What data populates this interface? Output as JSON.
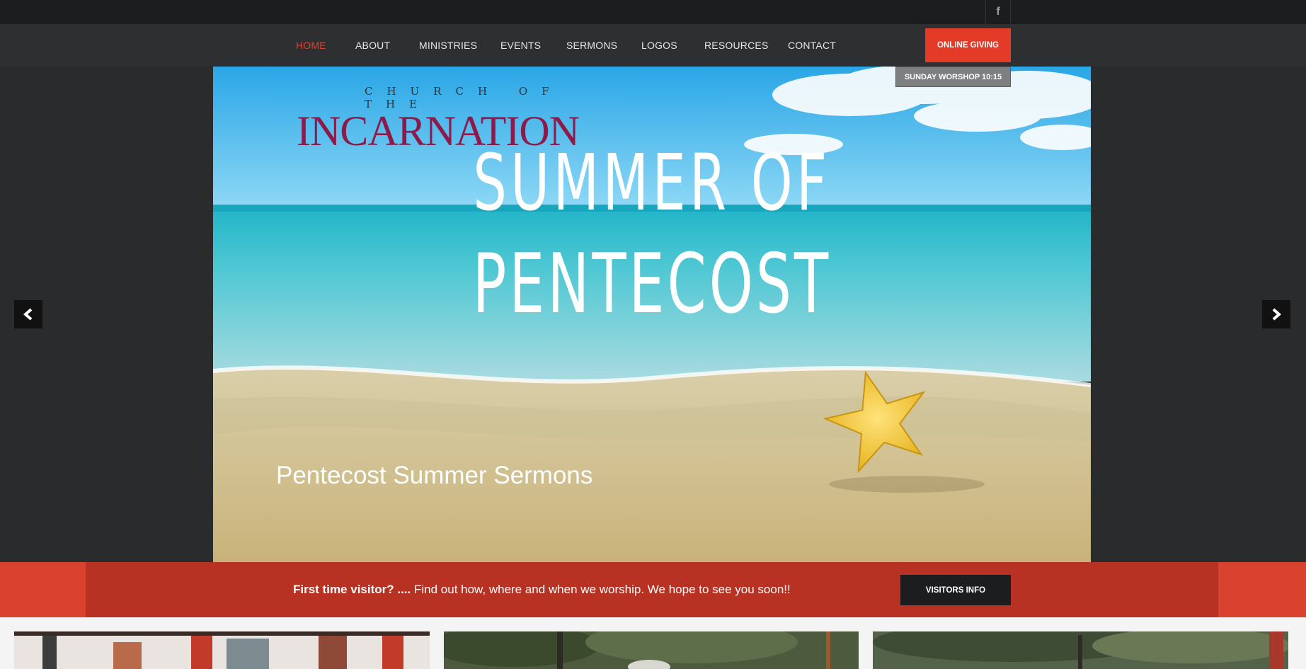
{
  "topbar": {
    "facebook_icon_label": "f"
  },
  "nav": {
    "items": [
      {
        "label": "HOME",
        "active": true
      },
      {
        "label": "ABOUT"
      },
      {
        "label": "MINISTRIES"
      },
      {
        "label": "EVENTS"
      },
      {
        "label": "SERMONS"
      },
      {
        "label": "LOGOS"
      },
      {
        "label": "RESOURCES"
      },
      {
        "label": "CONTACT"
      }
    ],
    "giving_label": "ONLINE GIVING"
  },
  "worship_badge": "SUNDAY WORSHOP 10:15",
  "hero": {
    "church_small": "CHURCH OF THE",
    "church_large": "INCARNATION",
    "headline_1": "SUMMER OF",
    "headline_2": "PENTECOST",
    "caption": "Pentecost Summer Sermons"
  },
  "cta": {
    "bold": "First time visitor? ....",
    "rest": " Find out how, where and when we worship. We hope to see you soon!!",
    "button_label": "VISITORS INFO"
  },
  "colors": {
    "accent": "#e33b28",
    "accent_dark": "#b83223",
    "church_maroon": "#8c1b4b"
  },
  "icons": {
    "prev": "chevron-left-icon",
    "next": "chevron-right-icon",
    "social": "facebook-icon"
  }
}
